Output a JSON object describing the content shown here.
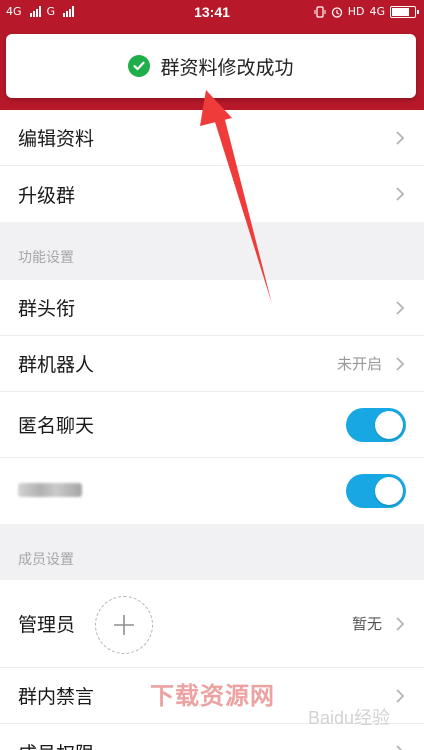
{
  "status_bar": {
    "net1": "4G",
    "net2": "G",
    "time": "13:41",
    "right_hd": "HD",
    "right_net": "4G",
    "battery_level_percent": 85
  },
  "toast": {
    "text": "群资料修改成功",
    "icon": "check-circle-icon"
  },
  "group_top": {
    "items": [
      {
        "label": "编辑资料"
      },
      {
        "label": "升级群"
      }
    ]
  },
  "section_function": {
    "title": "功能设置",
    "items": [
      {
        "label": "群头衔",
        "value": ""
      },
      {
        "label": "群机器人",
        "value": "未开启"
      },
      {
        "label": "匿名聊天",
        "toggle_on": true
      },
      {
        "label": "",
        "toggle_on": true
      }
    ]
  },
  "section_member": {
    "title": "成员设置",
    "items": [
      {
        "label": "管理员",
        "value": "暂无"
      },
      {
        "label": "群内禁言"
      },
      {
        "label": "成员权限"
      }
    ]
  },
  "watermarks": {
    "site": "下载资源网",
    "baidu": "Baidu经验"
  },
  "colors": {
    "header_red": "#b8192a",
    "toggle_blue": "#17a8e3",
    "success_green": "#1fae49",
    "arrow_red": "#f03b3b"
  }
}
